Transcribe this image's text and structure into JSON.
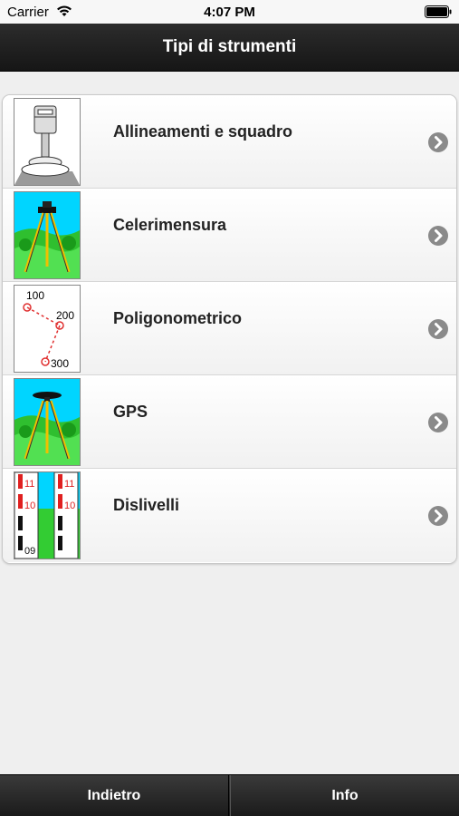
{
  "status_bar": {
    "carrier": "Carrier",
    "time": "4:07 PM"
  },
  "nav": {
    "title": "Tipi di strumenti"
  },
  "items": [
    {
      "label": "Allineamenti e squadro",
      "icon": "plumb-bob-icon"
    },
    {
      "label": "Celerimensura",
      "icon": "tripod-icon"
    },
    {
      "label": "Poligonometrico",
      "icon": "polygon-traverse-icon",
      "thumb_labels": [
        "100",
        "200",
        "300"
      ]
    },
    {
      "label": "GPS",
      "icon": "gps-tripod-icon"
    },
    {
      "label": "Dislivelli",
      "icon": "leveling-rod-icon",
      "thumb_labels": [
        "11",
        "10",
        "09",
        "11",
        "10"
      ]
    }
  ],
  "tab_bar": {
    "back_label": "Indietro",
    "info_label": "Info"
  },
  "colors": {
    "nav_bg": "#1e1e1e",
    "chevron": "#8a8a8a",
    "page_bg": "#efefef",
    "sky": "#00d5ff",
    "grass": "#33cc33"
  }
}
